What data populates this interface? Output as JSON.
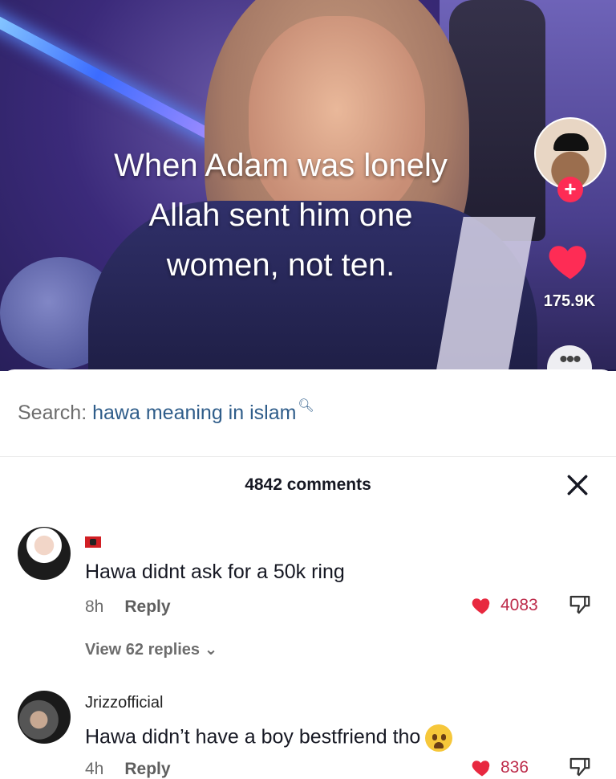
{
  "video": {
    "caption_lines": [
      "When Adam was lonely",
      "Allah sent him one",
      "women, not ten."
    ],
    "like_count": "175.9K",
    "follow_symbol": "+",
    "more_symbol": "•••",
    "heart_color": "#fe2c55"
  },
  "sheet": {
    "search_label": "Search:",
    "search_term": "hawa meaning in islam",
    "comments_title": "4842 comments"
  },
  "comments": [
    {
      "username": "",
      "text": "Hawa didnt ask for a 50k ring",
      "time": "8h",
      "reply_label": "Reply",
      "likes": "4083",
      "view_replies": "View 62 replies"
    },
    {
      "username": "Jrizzofficial",
      "text": "Hawa didn’t have a boy bestfriend tho",
      "time": "4h",
      "reply_label": "Reply",
      "likes": "836"
    }
  ],
  "colors": {
    "accent_red": "#fe2c55",
    "link_blue": "#2f5d8a",
    "like_red": "#bd2b4a"
  }
}
